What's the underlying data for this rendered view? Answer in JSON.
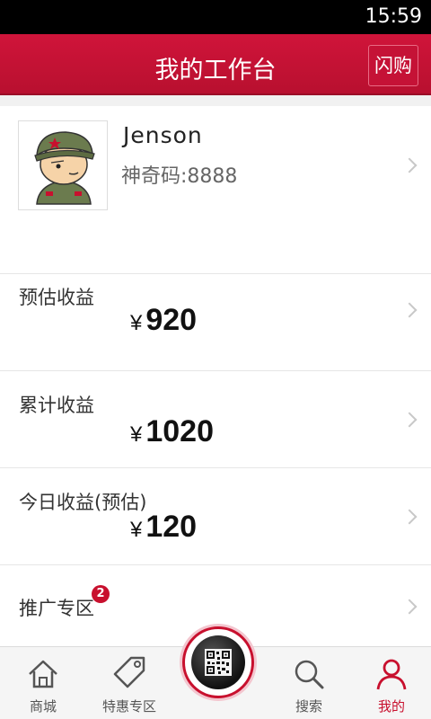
{
  "status": {
    "time": "15:59"
  },
  "header": {
    "title": "我的工作台",
    "action_label": "闪购"
  },
  "profile": {
    "name": "Jenson",
    "code_label": "神奇码:8888"
  },
  "stats": [
    {
      "label": "预估收益",
      "currency": "¥",
      "value": "920"
    },
    {
      "label": "累计收益",
      "currency": "¥",
      "value": "1020"
    },
    {
      "label": "今日收益(预估)",
      "currency": "¥",
      "value": "120"
    }
  ],
  "promo": {
    "label": "推广专区",
    "badge": "2"
  },
  "tabs": [
    {
      "label": "商城",
      "icon": "home-icon"
    },
    {
      "label": "特惠专区",
      "icon": "tag-icon"
    },
    {
      "label": "搜索",
      "icon": "search-icon"
    },
    {
      "label": "我的",
      "icon": "person-icon",
      "active": true
    }
  ],
  "colors": {
    "brand": "#c8102e",
    "background": "#ffffff"
  }
}
